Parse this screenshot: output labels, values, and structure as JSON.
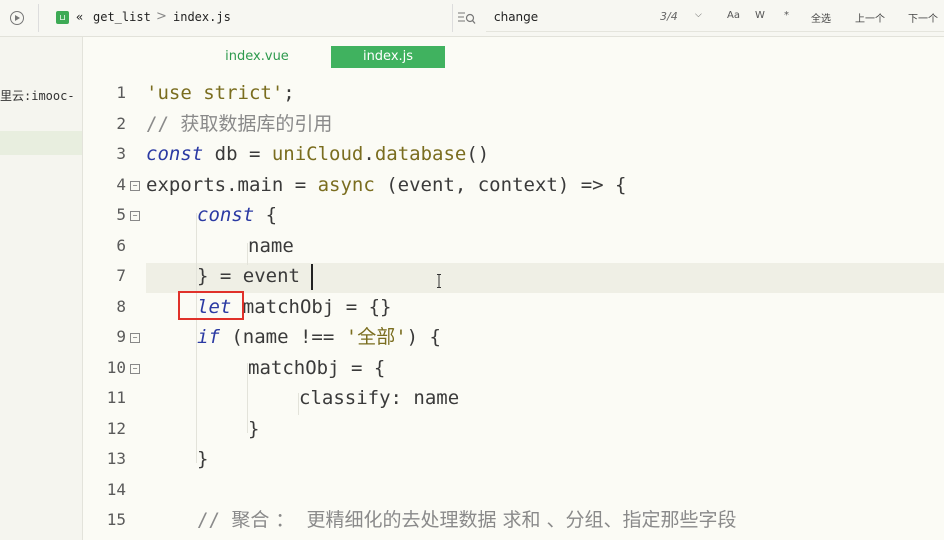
{
  "topbar": {
    "breadcrumb": [
      "«",
      "get_list",
      ">",
      "index.js"
    ],
    "search": {
      "value": "change",
      "placeholder": ""
    },
    "match_count": "3/4",
    "tools": [
      "Aa",
      "W",
      "*"
    ],
    "select_all": "全选",
    "prev": "上一个",
    "next": "下一个"
  },
  "sidebar": {
    "item_label": "里云:imooc-"
  },
  "tabs": [
    {
      "label": "index.vue",
      "active": false
    },
    {
      "label": "index.js",
      "active": true
    }
  ],
  "editor": {
    "lines": [
      {
        "n": "1",
        "fold": false,
        "indent": 0,
        "tokens": [
          [
            "str",
            "'use strict'"
          ],
          [
            "",
            ";"
          ]
        ]
      },
      {
        "n": "2",
        "fold": false,
        "indent": 0,
        "tokens": [
          [
            "comment",
            "// "
          ],
          [
            "comment cn",
            "获取数据库的引用"
          ]
        ]
      },
      {
        "n": "3",
        "fold": false,
        "indent": 0,
        "tokens": [
          [
            "kw",
            "const"
          ],
          [
            "",
            " db = "
          ],
          [
            "fn",
            "uniCloud"
          ],
          [
            "",
            "."
          ],
          [
            "fn",
            "database"
          ],
          [
            "",
            "()"
          ]
        ]
      },
      {
        "n": "4",
        "fold": true,
        "indent": 0,
        "tokens": [
          [
            "",
            "exports.main = "
          ],
          [
            "fn",
            "async"
          ],
          [
            "",
            " (event, context) => {"
          ]
        ]
      },
      {
        "n": "5",
        "fold": true,
        "indent": 1,
        "tokens": [
          [
            "kw",
            "const"
          ],
          [
            "",
            " {"
          ]
        ]
      },
      {
        "n": "6",
        "fold": false,
        "indent": 2,
        "tokens": [
          [
            "",
            "name"
          ]
        ]
      },
      {
        "n": "7",
        "fold": false,
        "indent": 1,
        "tokens": [
          [
            "",
            "} = event"
          ]
        ]
      },
      {
        "n": "8",
        "fold": false,
        "indent": 1,
        "tokens": [
          [
            "kw",
            "let"
          ],
          [
            "",
            " matchObj = {}"
          ]
        ]
      },
      {
        "n": "9",
        "fold": true,
        "indent": 1,
        "tokens": [
          [
            "kw",
            "if"
          ],
          [
            "",
            " (name !== "
          ],
          [
            "str",
            "'"
          ],
          [
            "str cn",
            "全部"
          ],
          [
            "str",
            "'"
          ],
          [
            "",
            ") {"
          ]
        ]
      },
      {
        "n": "10",
        "fold": true,
        "indent": 2,
        "tokens": [
          [
            "",
            "matchObj = {"
          ]
        ]
      },
      {
        "n": "11",
        "fold": false,
        "indent": 3,
        "tokens": [
          [
            "",
            "classify: name"
          ]
        ]
      },
      {
        "n": "12",
        "fold": false,
        "indent": 2,
        "tokens": [
          [
            "",
            "}"
          ]
        ]
      },
      {
        "n": "13",
        "fold": false,
        "indent": 1,
        "tokens": [
          [
            "",
            "}"
          ]
        ]
      },
      {
        "n": "14",
        "fold": false,
        "indent": 0,
        "tokens": []
      },
      {
        "n": "15",
        "fold": false,
        "indent": 1,
        "tokens": [
          [
            "comment",
            "// "
          ],
          [
            "comment cn",
            "聚合 ：  更精细化的去处理数据 求和 、分组、指定那些字段"
          ]
        ]
      }
    ]
  },
  "colors": {
    "accent_green": "#40b25f",
    "keyword_blue": "#2b3aa3",
    "string_olive": "#7a6d1f",
    "annotation_red": "#e0312a"
  }
}
